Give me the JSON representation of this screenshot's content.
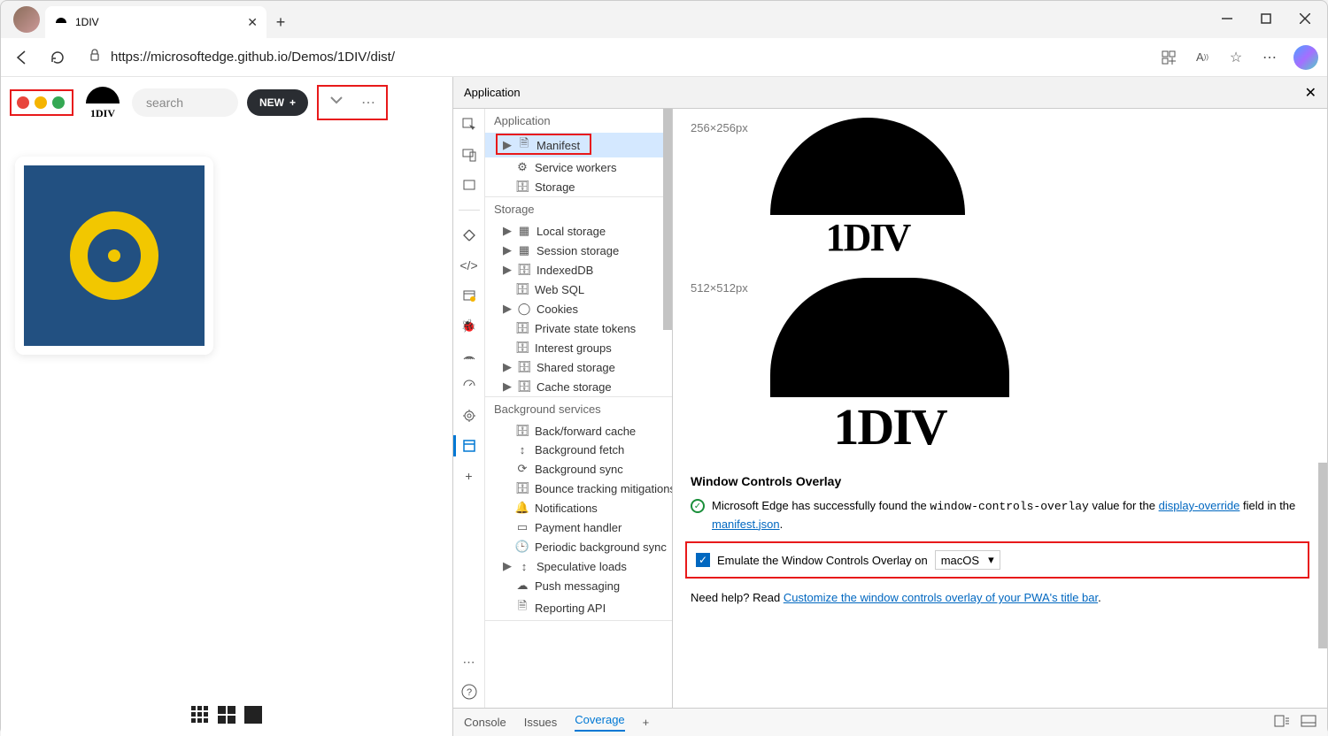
{
  "window": {
    "tab_title": "1DIV",
    "url": "https://microsoftedge.github.io/Demos/1DIV/dist/"
  },
  "page": {
    "logo_text": "1DIV",
    "search_placeholder": "search",
    "new_button": "NEW"
  },
  "devtools": {
    "panel_title": "Application",
    "tree": {
      "application": {
        "label": "Application",
        "items": [
          "Manifest",
          "Service workers",
          "Storage"
        ]
      },
      "storage": {
        "label": "Storage",
        "items": [
          "Local storage",
          "Session storage",
          "IndexedDB",
          "Web SQL",
          "Cookies",
          "Private state tokens",
          "Interest groups",
          "Shared storage",
          "Cache storage"
        ]
      },
      "background": {
        "label": "Background services",
        "items": [
          "Back/forward cache",
          "Background fetch",
          "Background sync",
          "Bounce tracking mitigations",
          "Notifications",
          "Payment handler",
          "Periodic background sync",
          "Speculative loads",
          "Push messaging",
          "Reporting API"
        ]
      }
    },
    "content": {
      "size_256": "256×256px",
      "size_512": "512×512px",
      "logo_text": "1DIV",
      "wco_heading": "Window Controls Overlay",
      "wco_msg_pre": "Microsoft Edge has successfully found the ",
      "wco_value": "window-controls-overlay",
      "wco_msg_mid": " value for the ",
      "wco_link1": "display-override",
      "wco_msg_post": " field in the ",
      "wco_link2": "manifest.json",
      "wco_period": ".",
      "emulate_label": "Emulate the Window Controls Overlay on",
      "emulate_os": "macOS",
      "help_pre": "Need help? Read ",
      "help_link": "Customize the window controls overlay of your PWA's title bar",
      "help_post": "."
    },
    "footer_tabs": [
      "Console",
      "Issues",
      "Coverage"
    ]
  }
}
